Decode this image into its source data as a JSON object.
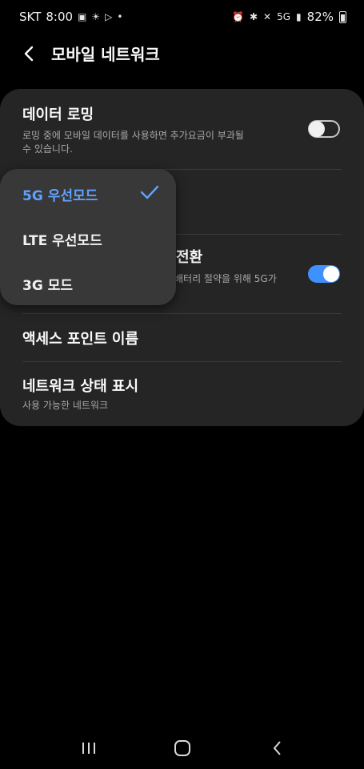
{
  "status_bar": {
    "carrier": "SKT",
    "time": "8:00",
    "net_badge": "5G",
    "battery": "82%"
  },
  "header": {
    "title": "모바일 네트워크"
  },
  "settings": {
    "data_roaming": {
      "title": "데이터 로밍",
      "subtitle_line1": "로밍 중에 모바일 데이터를 사용하면 추가요금이 부과될",
      "subtitle_line2": "수 있습니다.",
      "enabled": false
    },
    "smart_switch": {
      "title_visible": "전환",
      "subtitle_visible": "배터리 절약을 위해 5G가",
      "enabled": true
    },
    "access_point": {
      "title": "액세스 포인트 이름"
    },
    "network_status": {
      "title": "네트워크 상태 표시",
      "subtitle": "사용 가능한 네트워크"
    }
  },
  "network_mode_popup": {
    "options": [
      {
        "label": "5G 우선모드",
        "selected": true
      },
      {
        "label": "LTE 우선모드",
        "selected": false
      },
      {
        "label": "3G 모드",
        "selected": false
      }
    ]
  },
  "colors": {
    "accent": "#3e91ff",
    "selected_text": "#5ea3ff",
    "card_bg": "#252525",
    "popup_bg": "#383838"
  },
  "icons": {
    "back": "chevron-left-icon",
    "check": "check-icon",
    "nav_recents": "recents-icon",
    "nav_home": "home-icon",
    "nav_back": "back-icon"
  }
}
